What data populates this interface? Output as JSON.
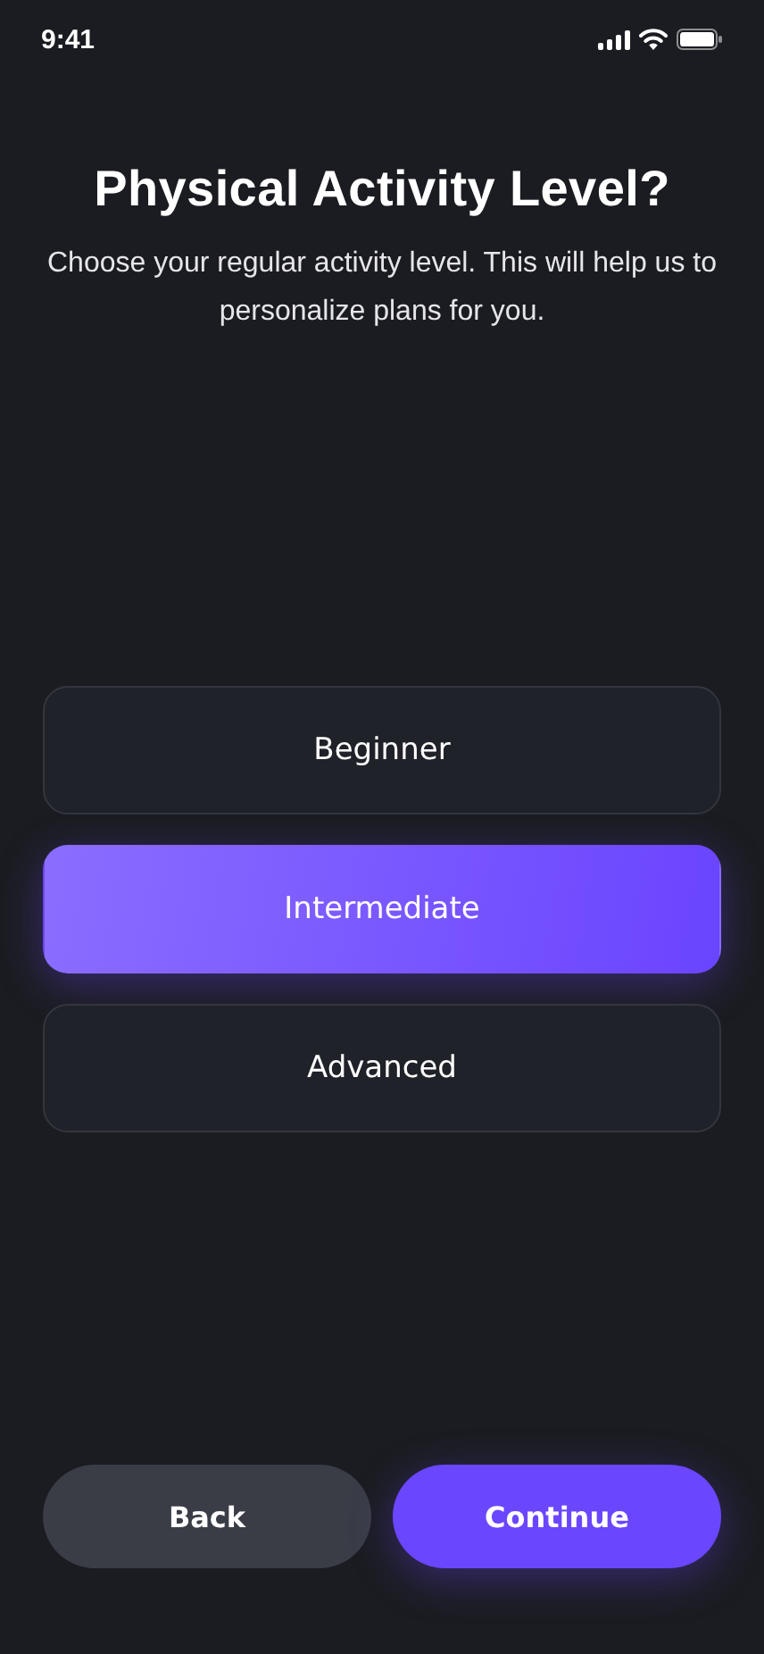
{
  "status_bar": {
    "time": "9:41"
  },
  "title": "Physical Activity Level?",
  "subtitle": "Choose your regular activity level. This will help us to personalize plans for you.",
  "options": [
    {
      "label": "Beginner",
      "selected": false
    },
    {
      "label": "Intermediate",
      "selected": true
    },
    {
      "label": "Advanced",
      "selected": false
    }
  ],
  "buttons": [
    {
      "label": "Back",
      "kind": "secondary"
    },
    {
      "label": "Continue",
      "kind": "primary"
    }
  ]
}
